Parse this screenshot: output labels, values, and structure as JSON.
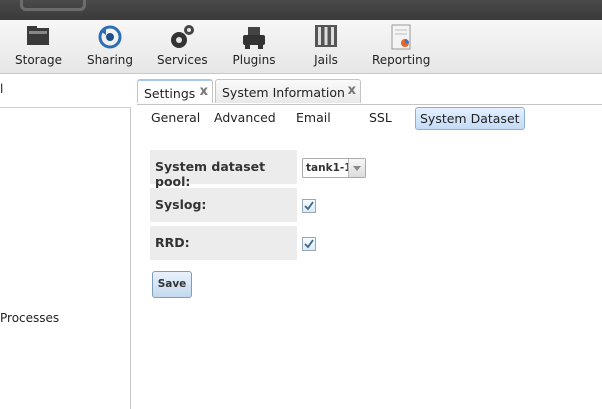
{
  "toolbar": {
    "items": [
      {
        "label": "Storage",
        "icon": "storage-icon"
      },
      {
        "label": "Sharing",
        "icon": "sharing-icon"
      },
      {
        "label": "Services",
        "icon": "services-icon"
      },
      {
        "label": "Plugins",
        "icon": "plugins-icon"
      },
      {
        "label": "Jails",
        "icon": "jails-icon"
      },
      {
        "label": "Reporting",
        "icon": "reporting-icon"
      }
    ]
  },
  "left_pane": {
    "header_fragment": "l",
    "item_fragment": "Processes"
  },
  "tabs": [
    {
      "label": "Settings",
      "close": "x",
      "active": true
    },
    {
      "label": "System Information",
      "close": "x",
      "active": false
    }
  ],
  "subtabs": [
    {
      "label": "General"
    },
    {
      "label": "Advanced"
    },
    {
      "label": "Email"
    },
    {
      "label": "SSL"
    },
    {
      "label": "System Dataset",
      "active": true
    }
  ],
  "form": {
    "pool": {
      "label": "System dataset pool:",
      "value": "tank1-1"
    },
    "syslog": {
      "label": "Syslog:",
      "checked": true
    },
    "rrd": {
      "label": "RRD:",
      "checked": true
    },
    "save_label": "Save"
  },
  "colors": {
    "topbar": "#3f3f3f",
    "active_subtab": "#c4dcf7",
    "label_bg": "#ececec"
  }
}
